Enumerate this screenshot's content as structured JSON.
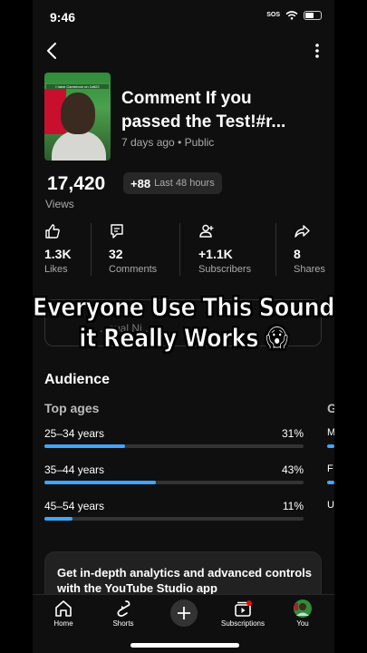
{
  "status_bar": {
    "time": "9:46",
    "sos": "SOS"
  },
  "video": {
    "thumbnail_caption": "I have Cameroon on 1stt22",
    "title_line1": "Comment If you",
    "title_line2": "passed the Test!#r...",
    "age": "7 days ago",
    "visibility": "Public",
    "meta_separator": "•"
  },
  "views": {
    "count": "17,420",
    "label": "Views",
    "delta": "+88",
    "delta_period": "Last 48 hours"
  },
  "stats": [
    {
      "icon": "thumbs-up-icon",
      "value": "1.3K",
      "label": "Likes"
    },
    {
      "icon": "comment-icon",
      "value": "32",
      "label": "Comments"
    },
    {
      "icon": "add-person-icon",
      "value": "+1.1K",
      "label": "Subscribers"
    },
    {
      "icon": "share-icon",
      "value": "8",
      "label": "Shares"
    }
  ],
  "snippet": {
    "partial_text": "...sual Ni..."
  },
  "overlay": {
    "line1": "Everyone Use This Sound",
    "line2": "it Really Works 😱"
  },
  "audience": {
    "title": "Audience",
    "top_ages_title": "Top ages",
    "next_title_peek": "G",
    "ages": [
      {
        "label": "25–34 years",
        "percent_text": "31%",
        "percent": 31
      },
      {
        "label": "35–44 years",
        "percent_text": "43%",
        "percent": 43
      },
      {
        "label": "45–54 years",
        "percent_text": "11%",
        "percent": 11
      }
    ],
    "next_peek_letters": [
      "M",
      "F",
      "U"
    ]
  },
  "promo": {
    "text": "Get in-depth analytics and advanced controls with the YouTube Studio app"
  },
  "nav": [
    {
      "icon": "home-icon",
      "label": "Home"
    },
    {
      "icon": "shorts-icon",
      "label": "Shorts"
    },
    {
      "icon": "create-icon",
      "label": ""
    },
    {
      "icon": "subscriptions-icon",
      "label": "Subscriptions"
    },
    {
      "icon": "you-avatar-icon",
      "label": "You"
    }
  ],
  "colors": {
    "accent": "#3ea6ff",
    "background": "#0f0f0f",
    "muted": "#aaaaaa",
    "badge": "#272727"
  }
}
